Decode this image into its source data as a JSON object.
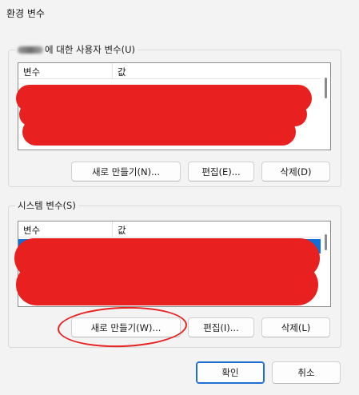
{
  "window": {
    "title": "환경 변수"
  },
  "user_section": {
    "legend_suffix": "에 대한 사용자 변수(U)",
    "columns": [
      "변수",
      "값"
    ],
    "buttons": {
      "new": "새로 만들기(N)...",
      "edit": "편집(E)...",
      "delete": "삭제(D)"
    }
  },
  "system_section": {
    "legend": "시스템 변수(S)",
    "columns": [
      "변수",
      "값"
    ],
    "buttons": {
      "new": "새로 만들기(W)...",
      "edit": "편집(I)...",
      "delete": "삭제(L)"
    }
  },
  "dialog_buttons": {
    "ok": "확인",
    "cancel": "취소"
  },
  "colors": {
    "redaction": "#e8201f",
    "selection": "#0f6fd8",
    "primary_border": "#1f6fd1"
  }
}
